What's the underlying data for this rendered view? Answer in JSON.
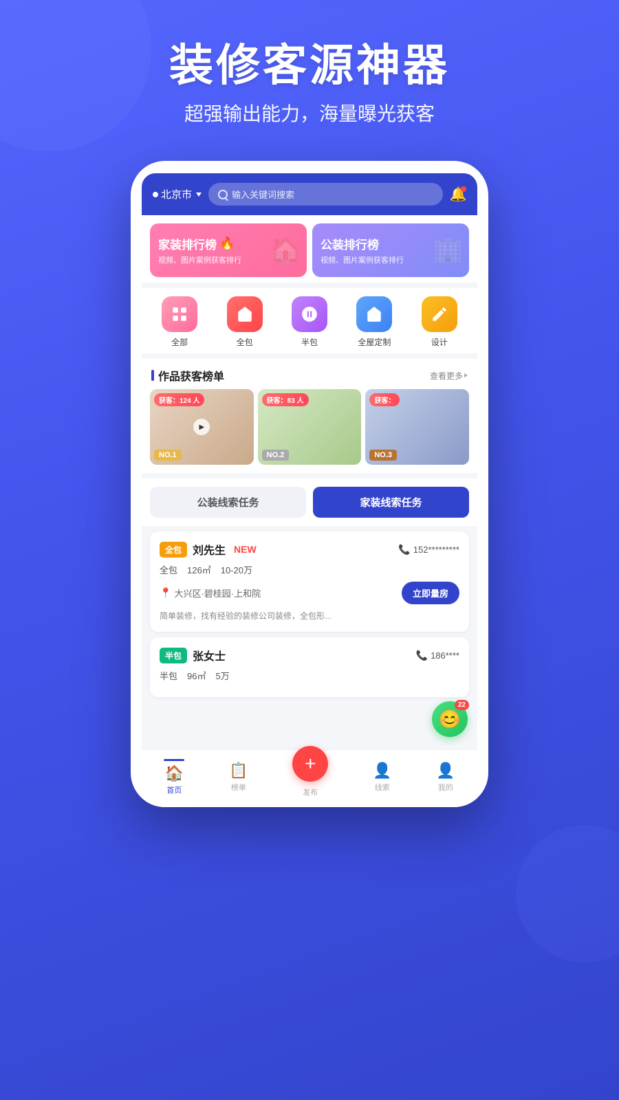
{
  "hero": {
    "title": "装修客源神器",
    "subtitle": "超强输出能力，海量曝光获客"
  },
  "topbar": {
    "location": "北京市",
    "search_placeholder": "输入关键词搜索"
  },
  "banners": [
    {
      "title": "家装排行榜",
      "subtitle": "视频、图片案例获客排行",
      "type": "home"
    },
    {
      "title": "公装排行榜",
      "subtitle": "视频、图片案例获客排行",
      "type": "office"
    }
  ],
  "categories": [
    {
      "label": "全部",
      "color": "pink"
    },
    {
      "label": "全包",
      "color": "red"
    },
    {
      "label": "半包",
      "color": "purple"
    },
    {
      "label": "全屋定制",
      "color": "blue"
    },
    {
      "label": "设计",
      "color": "orange"
    }
  ],
  "section": {
    "title": "作品获客榜单",
    "see_more": "查看更多"
  },
  "work_cards": [
    {
      "badge": "获客：124 人",
      "rank": "NO.1",
      "has_play": true
    },
    {
      "badge": "获客：83 人",
      "rank": "NO.2",
      "has_play": false
    },
    {
      "badge": "获客：",
      "rank": "NO.3",
      "has_play": false
    }
  ],
  "task_tabs": [
    {
      "label": "公装线索任务",
      "active": false
    },
    {
      "label": "家装线索任务",
      "active": true
    }
  ],
  "leads": [
    {
      "tag": "全包",
      "tag_color": "orange",
      "name": "刘先生",
      "is_new": true,
      "new_label": "NEW",
      "phone": "152*********",
      "details": [
        "全包",
        "126㎡",
        "10-20万"
      ],
      "location": "大兴区·碧桂园·上和院",
      "action": "立即量房",
      "desc": "简单装修，找有经验的装修公司装修，全包形..."
    },
    {
      "tag": "半包",
      "tag_color": "green",
      "name": "张女士",
      "is_new": false,
      "new_label": "",
      "phone": "186****",
      "details": [
        "半包",
        "96㎡",
        "5万"
      ],
      "location": "",
      "action": "",
      "desc": ""
    }
  ],
  "bottom_nav": [
    {
      "label": "首页",
      "active": true,
      "icon": "🏠"
    },
    {
      "label": "榜单",
      "active": false,
      "icon": "📋"
    },
    {
      "label": "发布",
      "active": false,
      "icon": "+"
    },
    {
      "label": "线索",
      "active": false,
      "icon": "👤"
    },
    {
      "label": "我的",
      "active": false,
      "icon": "👤"
    }
  ],
  "chat": {
    "badge": "22"
  }
}
